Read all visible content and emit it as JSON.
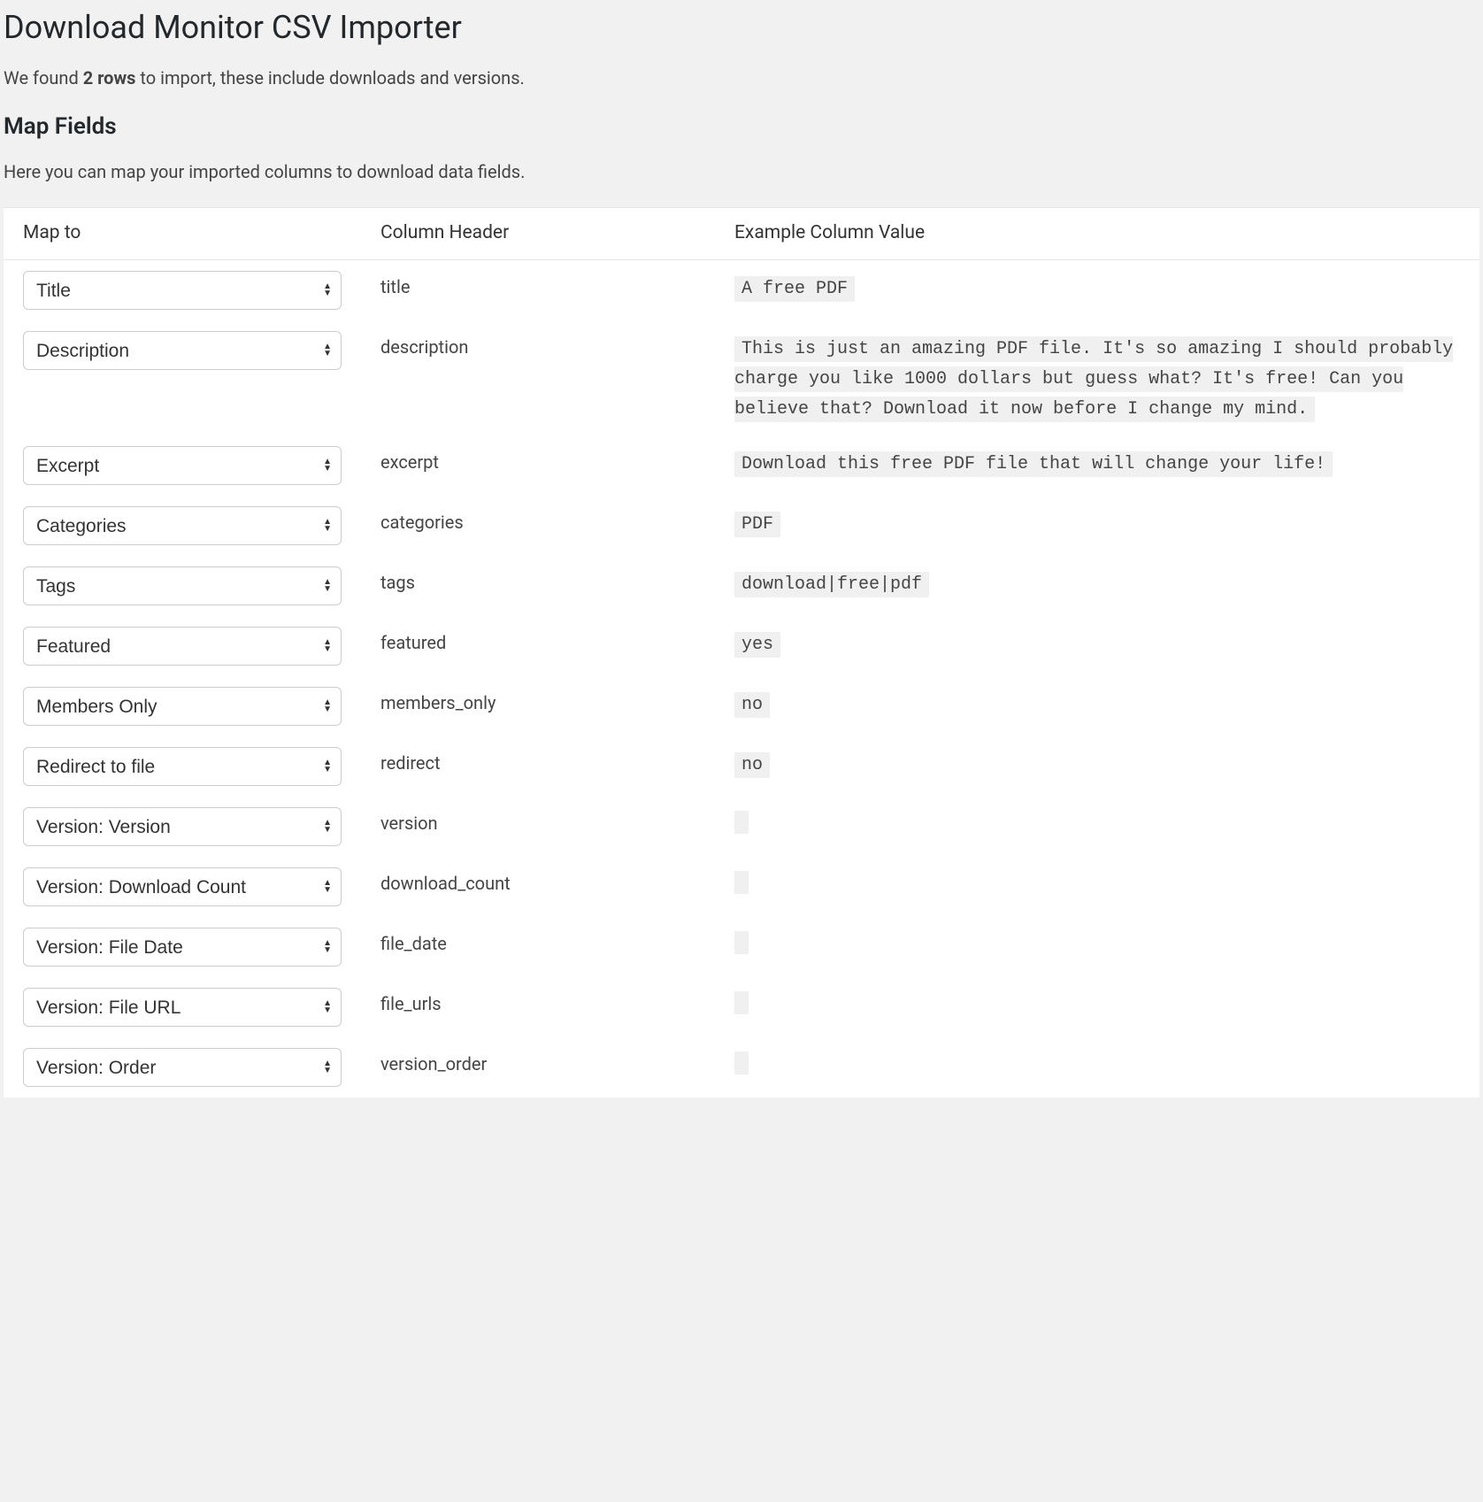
{
  "title": "Download Monitor CSV Importer",
  "intro": {
    "pre": "We found ",
    "bold": "2 rows",
    "post": " to import, these include downloads and versions."
  },
  "section_title": "Map Fields",
  "section_desc": "Here you can map your imported columns to download data fields.",
  "columns": {
    "map_to": "Map to",
    "header": "Column Header",
    "example": "Example Column Value"
  },
  "select_options": [
    "Title",
    "Description",
    "Excerpt",
    "Categories",
    "Tags",
    "Featured",
    "Members Only",
    "Redirect to file",
    "Version: Version",
    "Version: Download Count",
    "Version: File Date",
    "Version: File URL",
    "Version: Order"
  ],
  "rows": [
    {
      "selected": "Title",
      "header": "title",
      "example": "A free PDF"
    },
    {
      "selected": "Description",
      "header": "description",
      "example": "This is just an amazing PDF file. It's so amazing I should probably charge you like 1000 dollars but guess what? It's free! Can you believe that? Download it now before I change my mind."
    },
    {
      "selected": "Excerpt",
      "header": "excerpt",
      "example": "Download this free PDF file that will change your life!"
    },
    {
      "selected": "Categories",
      "header": "categories",
      "example": "PDF"
    },
    {
      "selected": "Tags",
      "header": "tags",
      "example": "download|free|pdf"
    },
    {
      "selected": "Featured",
      "header": "featured",
      "example": "yes"
    },
    {
      "selected": "Members Only",
      "header": "members_only",
      "example": "no"
    },
    {
      "selected": "Redirect to file",
      "header": "redirect",
      "example": "no"
    },
    {
      "selected": "Version: Version",
      "header": "version",
      "example": ""
    },
    {
      "selected": "Version: Download Count",
      "header": "download_count",
      "example": ""
    },
    {
      "selected": "Version: File Date",
      "header": "file_date",
      "example": ""
    },
    {
      "selected": "Version: File URL",
      "header": "file_urls",
      "example": ""
    },
    {
      "selected": "Version: Order",
      "header": "version_order",
      "example": ""
    }
  ]
}
